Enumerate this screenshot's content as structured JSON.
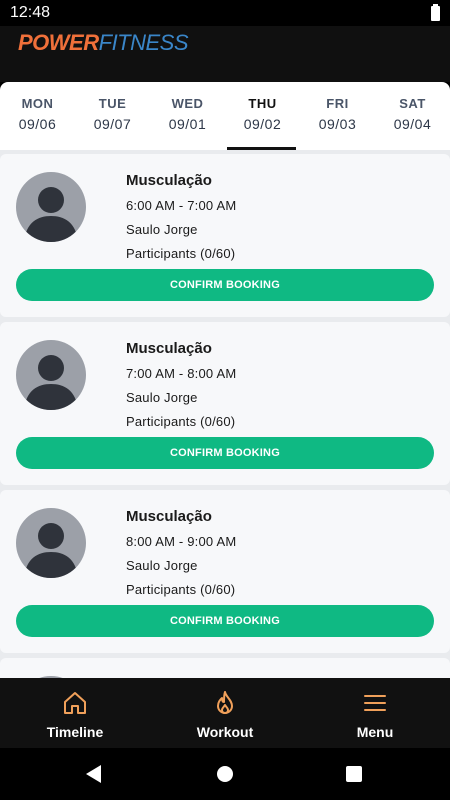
{
  "status": {
    "time": "12:48"
  },
  "brand": {
    "part1": "POWER",
    "part2": "FITNESS"
  },
  "days": [
    {
      "name": "MON",
      "date": "09/06",
      "active": false
    },
    {
      "name": "TUE",
      "date": "09/07",
      "active": false
    },
    {
      "name": "WED",
      "date": "09/01",
      "active": false
    },
    {
      "name": "THU",
      "date": "09/02",
      "active": true
    },
    {
      "name": "FRI",
      "date": "09/03",
      "active": false
    },
    {
      "name": "SAT",
      "date": "09/04",
      "active": false
    }
  ],
  "classes": [
    {
      "title": "Musculação",
      "time": "6:00 AM - 7:00 AM",
      "instructor": "Saulo Jorge",
      "participants": "Participants (0/60)",
      "button": "CONFIRM BOOKING"
    },
    {
      "title": "Musculação",
      "time": "7:00 AM - 8:00 AM",
      "instructor": "Saulo Jorge",
      "participants": "Participants (0/60)",
      "button": "CONFIRM BOOKING"
    },
    {
      "title": "Musculação",
      "time": "8:00 AM - 9:00 AM",
      "instructor": "Saulo Jorge",
      "participants": "Participants (0/60)",
      "button": "CONFIRM BOOKING"
    },
    {
      "title": "",
      "time": "",
      "instructor": "",
      "participants": "",
      "button": ""
    }
  ],
  "nav": [
    {
      "label": "Timeline",
      "icon": "home-icon"
    },
    {
      "label": "Workout",
      "icon": "flame-icon"
    },
    {
      "label": "Menu",
      "icon": "menu-icon"
    }
  ],
  "colors": {
    "accent": "#0fb983",
    "nav_icon": "#f0a05a",
    "brand_orange": "#f0703a",
    "brand_blue": "#3a86c9"
  }
}
